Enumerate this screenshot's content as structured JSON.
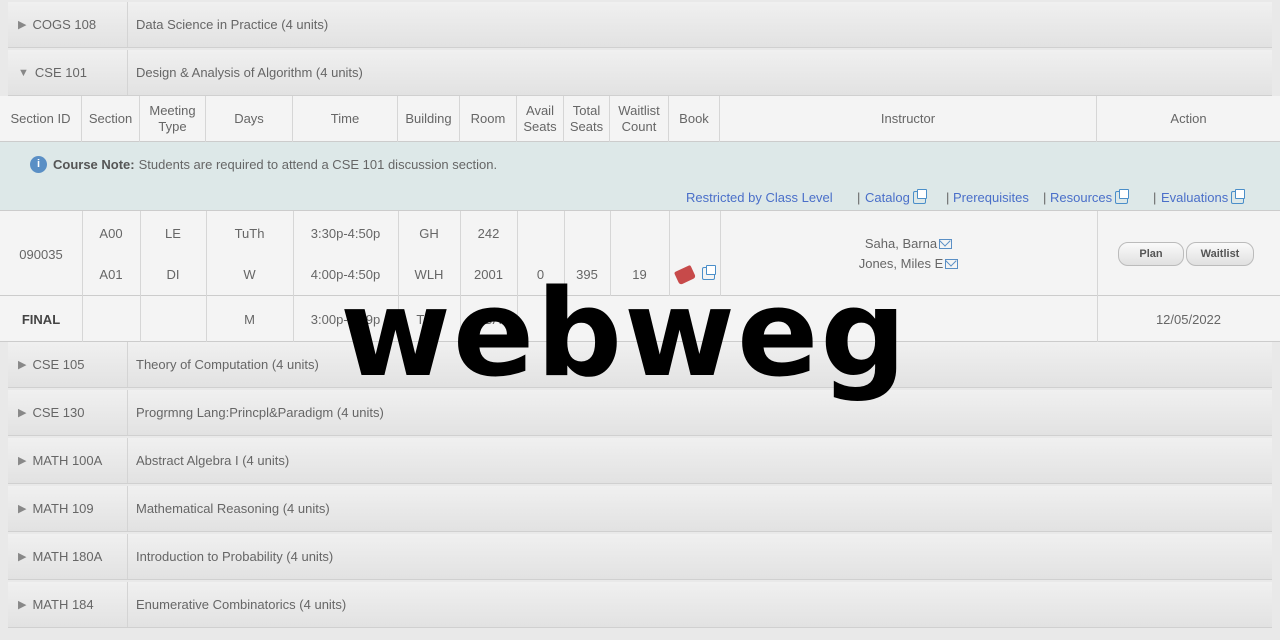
{
  "courses_top": [
    {
      "code": "COGS 108",
      "title": "Data Science in Practice (4 units)",
      "expanded": false
    },
    {
      "code": "CSE  101",
      "title": "Design & Analysis of Algorithm (4 units)",
      "expanded": true
    }
  ],
  "table_headers": {
    "section_id": "Section ID",
    "section": "Section",
    "meeting_type": "Meeting Type",
    "days": "Days",
    "time": "Time",
    "building": "Building",
    "room": "Room",
    "avail_seats": "Avail Seats",
    "total_seats": "Total Seats",
    "waitlist_count": "Waitlist Count",
    "book": "Book",
    "instructor": "Instructor",
    "action": "Action"
  },
  "note": {
    "label": "Course Note:",
    "text": "Students are required to attend a CSE 101 discussion section."
  },
  "links": {
    "restricted": "Restricted by Class Level",
    "catalog": "Catalog",
    "prerequisites": "Prerequisites",
    "resources": "Resources",
    "evaluations": "Evaluations",
    "sep": "|"
  },
  "section": {
    "section_id": "090035",
    "rows": [
      {
        "section": "A00",
        "type": "LE",
        "days": "TuTh",
        "time": "3:30p-4:50p",
        "building": "GH",
        "room": "242"
      },
      {
        "section": "A01",
        "type": "DI",
        "days": "W",
        "time": "4:00p-4:50p",
        "building": "WLH",
        "room": "2001"
      }
    ],
    "avail_seats": "0",
    "total_seats": "395",
    "waitlist_count": "19",
    "instructors": [
      "Saha, Barna",
      "Jones, Miles E"
    ],
    "plan_label": "Plan",
    "waitlist_label": "Waitlist"
  },
  "final": {
    "label": "FINAL",
    "days": "M",
    "time": "3:00p-5:59p",
    "building": "TBA",
    "room": "TBA",
    "date": "12/05/2022"
  },
  "courses_bottom": [
    {
      "code": "CSE  105",
      "title": "Theory of Computation (4 units)"
    },
    {
      "code": "CSE  130",
      "title": "Progrmng Lang:Princpl&Paradigm (4 units)"
    },
    {
      "code": "MATH 100A",
      "title": "Abstract Algebra I (4 units)"
    },
    {
      "code": "MATH 109",
      "title": "Mathematical Reasoning (4 units)"
    },
    {
      "code": "MATH 180A",
      "title": "Introduction to Probability (4 units)"
    },
    {
      "code": "MATH 184",
      "title": "Enumerative Combinatorics (4 units)"
    }
  ],
  "watermark": "webweg",
  "colors": {
    "link": "#4a6fc9",
    "note_bg": "#dde8e8",
    "book": "#c74a4a"
  }
}
